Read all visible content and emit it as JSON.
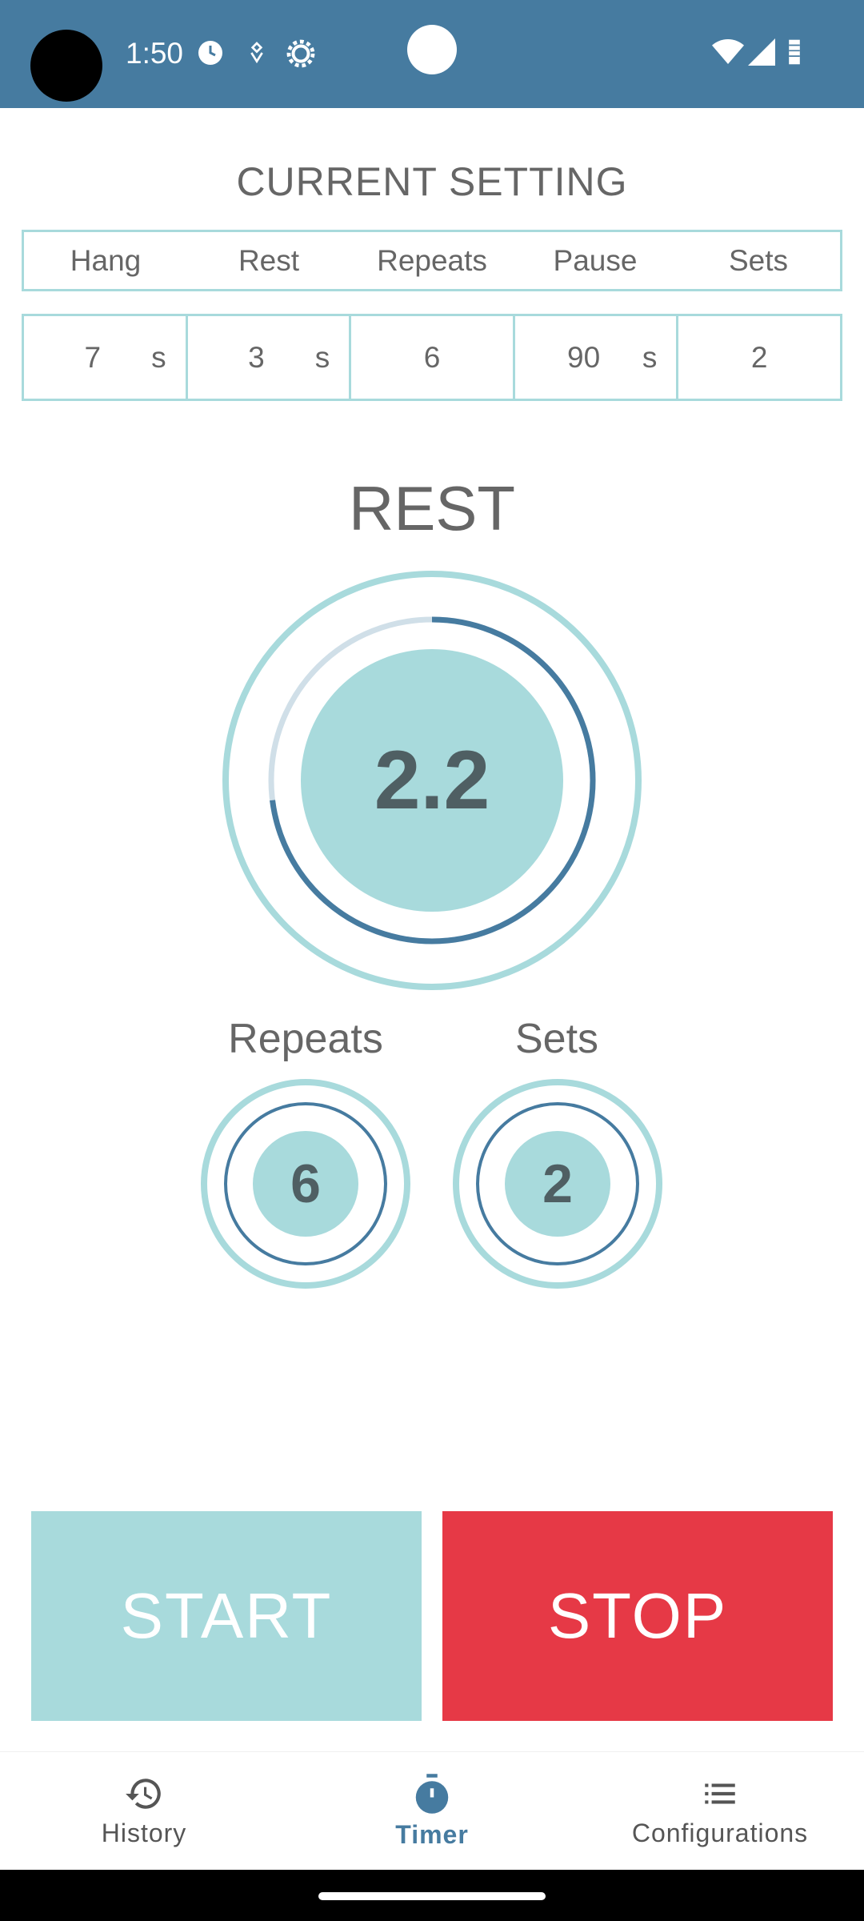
{
  "status_bar": {
    "time": "1:50",
    "icons": [
      "alarm-icon",
      "location-icon",
      "settings-gear-icon",
      "wifi-icon",
      "signal-icon",
      "battery-icon"
    ]
  },
  "current_setting": {
    "title": "CURRENT SETTING",
    "headers": [
      "Hang",
      "Rest",
      "Repeats",
      "Pause",
      "Sets"
    ],
    "values": [
      {
        "value": "7",
        "unit": "s"
      },
      {
        "value": "3",
        "unit": "s"
      },
      {
        "value": "6",
        "unit": ""
      },
      {
        "value": "90",
        "unit": "s"
      },
      {
        "value": "2",
        "unit": ""
      }
    ]
  },
  "timer": {
    "phase": "REST",
    "value": "2.2",
    "progress": 0.73,
    "colors": {
      "ring": "#a8dadc",
      "progress": "#467ba0",
      "track": "#d0dfe8",
      "core": "#a8dadc"
    }
  },
  "counters": {
    "repeats": {
      "label": "Repeats",
      "value": "6"
    },
    "sets": {
      "label": "Sets",
      "value": "2"
    }
  },
  "buttons": {
    "start": "START",
    "stop": "STOP",
    "colors": {
      "start": "#a8dadc",
      "stop": "#e63946"
    }
  },
  "nav": {
    "items": [
      {
        "label": "History",
        "icon": "history-icon"
      },
      {
        "label": "Timer",
        "icon": "stopwatch-icon"
      },
      {
        "label": "Configurations",
        "icon": "list-icon"
      }
    ],
    "active": "Timer"
  }
}
